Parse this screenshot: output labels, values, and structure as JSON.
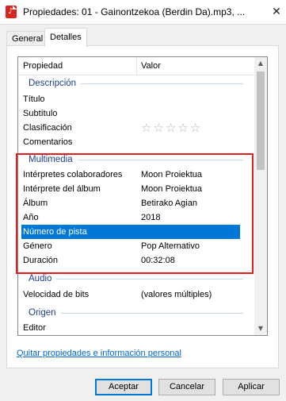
{
  "window": {
    "title": "Propiedades: 01 - Gainontzekoa (Berdin Da).mp3, ...",
    "close_glyph": "✕"
  },
  "tabs": [
    {
      "label": "General"
    },
    {
      "label": "Detalles",
      "active": true
    }
  ],
  "columns": {
    "property": "Propiedad",
    "value": "Valor"
  },
  "groups": {
    "descripcion": "Descripción",
    "multimedia": "Multimedia",
    "audio": "Audio",
    "origen": "Origen"
  },
  "rows": {
    "titulo": {
      "k": "Título",
      "v": ""
    },
    "subtitulo": {
      "k": "Subtítulo",
      "v": ""
    },
    "clasificacion": {
      "k": "Clasificación",
      "v": "☆☆☆☆☆"
    },
    "comentarios": {
      "k": "Comentarios",
      "v": ""
    },
    "interpretes": {
      "k": "Intérpretes colaboradores",
      "v": "Moon Proiektua"
    },
    "interprete_album": {
      "k": "Intérprete del álbum",
      "v": "Moon Proiektua"
    },
    "album": {
      "k": "Álbum",
      "v": "Betirako Agian"
    },
    "anio": {
      "k": "Año",
      "v": "2018"
    },
    "numero_pista": {
      "k": "Número de pista",
      "v": ""
    },
    "genero": {
      "k": "Género",
      "v": "Pop Alternativo"
    },
    "duracion": {
      "k": "Duración",
      "v": "00:32:08"
    },
    "velocidad_bits": {
      "k": "Velocidad de bits",
      "v": "(valores múltiples)"
    },
    "editor": {
      "k": "Editor",
      "v": ""
    }
  },
  "rating": {
    "stars_total": 5,
    "stars_filled": 0
  },
  "link": {
    "label": "Quitar propiedades e información personal"
  },
  "buttons": {
    "aceptar": "Aceptar",
    "cancelar": "Cancelar",
    "aplicar": "Aplicar"
  },
  "icons": {
    "app": "audio-file-icon",
    "scroll_up": "▲",
    "scroll_down": "▼"
  },
  "colors": {
    "accent": "#0078d7",
    "group": "#1e3f8f",
    "highlight": "#e02020",
    "link": "#0066cc"
  }
}
